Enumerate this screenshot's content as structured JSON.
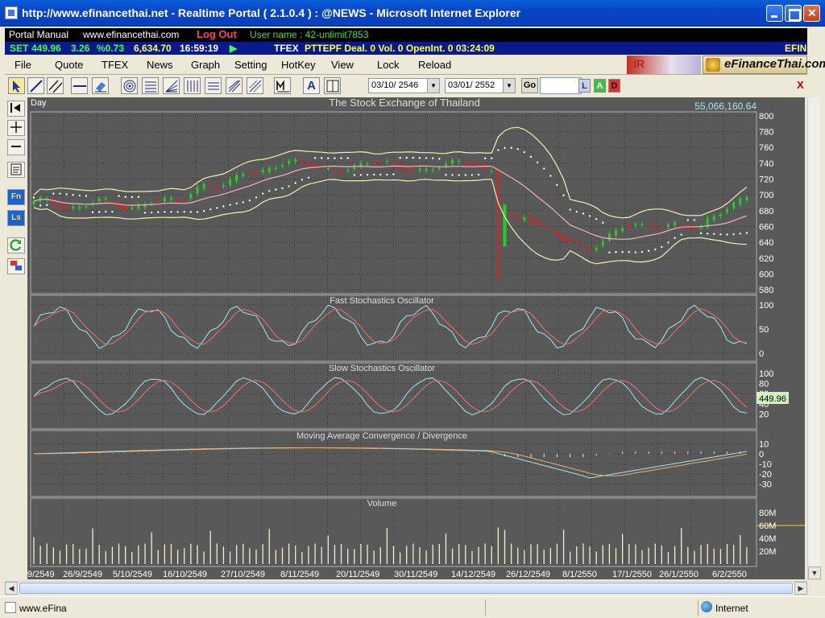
{
  "window": {
    "title": "http://www.efinancethai.net - Realtime Portal ( 2.1.0.4 ) : @NEWS - Microsoft Internet Explorer"
  },
  "infobar": {
    "portal_manual": "Portal Manual",
    "site": "www.efinancethai.com",
    "logout": "Log Out",
    "user": "User name : 42-unlimit7853"
  },
  "ticker": {
    "set_label": "SET",
    "set_value": "449.96",
    "set_change": "3.26",
    "set_pct": "%0.73",
    "volume": "6,634.70",
    "time": "16:59:19",
    "tfex_label": "TFEX",
    "tfex_info": "PTTEPF Deal. 0  Vol. 0  OpenInt. 0  03:24:09",
    "efin": "EFIN"
  },
  "menu": [
    "File",
    "Quote",
    "TFEX",
    "News",
    "Graph",
    "Setting",
    "HotKey",
    "View",
    "Lock",
    "Reload"
  ],
  "banners": {
    "ir": "IR",
    "efin": "eFinanceThai.com"
  },
  "toolbar": {
    "date_from": "03/10/ 2546",
    "date_to": "03/01/ 2552",
    "go": "Go",
    "l": "L",
    "a": "A",
    "d": "D",
    "text_a": "A",
    "close": "X"
  },
  "leftstrip": {
    "fn": "Fn",
    "ls": "Ls"
  },
  "chart": {
    "period": "Day",
    "title": "The Stock Exchange of Thailand",
    "top_value": "55,066,160.64",
    "price_axis": [
      "800",
      "780",
      "760",
      "740",
      "720",
      "700",
      "680",
      "660",
      "640",
      "620",
      "600",
      "580"
    ],
    "fast_title": "Fast Stochastics Oscillator",
    "fast_axis": [
      "100",
      "50",
      "0"
    ],
    "slow_title": "Slow Stochastics Oscillator",
    "slow_axis": [
      "100",
      "80",
      "60",
      "40",
      "20"
    ],
    "slow_marker": "449.96",
    "macd_title": "Moving Average Convergence / Divergence",
    "macd_axis": [
      "10",
      "0",
      "-10",
      "-20",
      "-30"
    ],
    "vol_title": "Volume",
    "vol_axis": [
      "80M",
      "60M",
      "40M",
      "20M"
    ],
    "x_labels": [
      "9/2549",
      "26/9/2549",
      "5/10/2549",
      "16/10/2549",
      "27/10/2549",
      "8/11/2549",
      "20/11/2549",
      "30/11/2549",
      "14/12/2549",
      "26/12/2549",
      "8/1/2550",
      "17/1/2550",
      "26/1/2550",
      "6/2/2550"
    ]
  },
  "status": {
    "text": "www.eFina",
    "zone": "Internet"
  },
  "colors": {
    "chart_bg": "#595959",
    "up": "#22d022",
    "down": "#e02020",
    "band": "#f0f0b0",
    "mid": "#f0b0c0",
    "fast": "#a0e8f0",
    "slow_sig": "#f07070"
  }
}
